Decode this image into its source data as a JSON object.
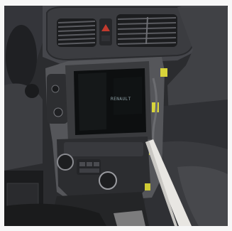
{
  "photo": {
    "subject": "car-dashboard-center-console",
    "screen_text": "RENAULT",
    "colors": {
      "dashboard": "#3a3b3f",
      "dashboard_dark": "#1e1f22",
      "trim_plastic": "#58595d",
      "screen": "#0d0f10",
      "clip_yellow": "#d8d43a",
      "pry_tool": "#e8e6e2",
      "door_panel": "#d9d9d9"
    }
  }
}
